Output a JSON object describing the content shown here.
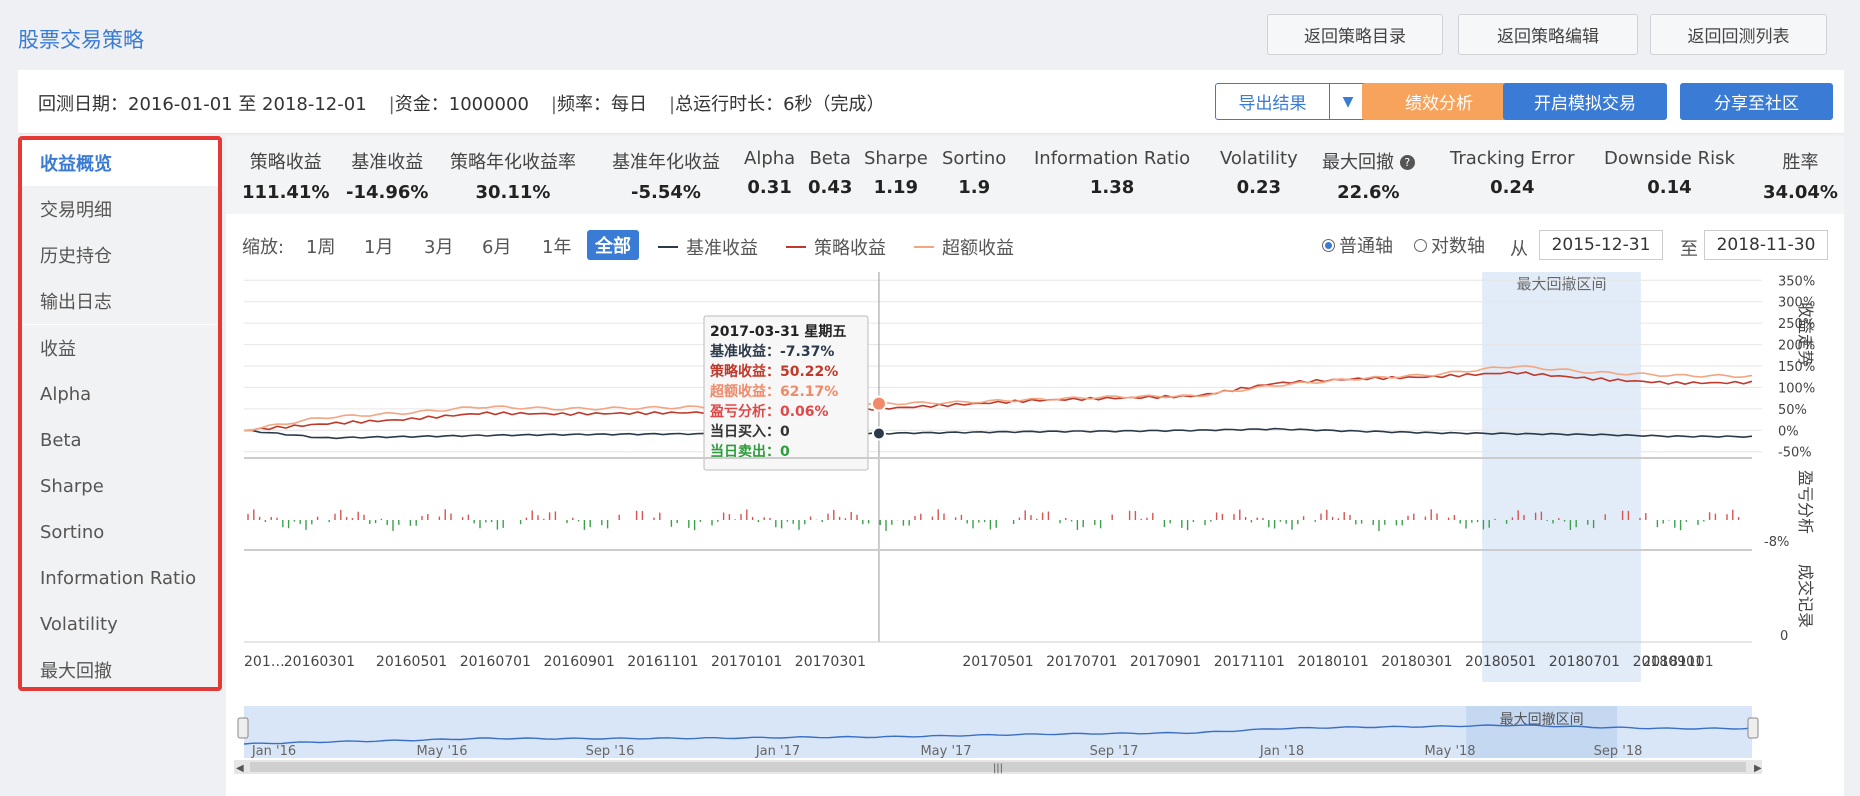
{
  "app_title": "股票交易策略",
  "top_buttons": [
    "返回策略目录",
    "返回策略编辑",
    "返回回测列表"
  ],
  "info": {
    "date_range": "回测日期：2016-01-01 至 2018-12-01",
    "capital": "资金：1000000",
    "frequency": "频率：每日",
    "runtime": "总运行时长：6秒（完成）",
    "separator": "|"
  },
  "actions": {
    "export": "导出结果",
    "performance": "绩效分析",
    "simulate": "开启模拟交易",
    "share": "分享至社区"
  },
  "colors": {
    "accent": "#3a7bd5",
    "orange": "#f7a35c",
    "benchmark": "#2b3a4a",
    "strategy": "#c0392b",
    "excess": "#f4a582",
    "highlight": "#e53935"
  },
  "sidebar": [
    {
      "label": "收益概览",
      "active": true
    },
    {
      "label": "交易明细"
    },
    {
      "label": "历史持仓"
    },
    {
      "label": "输出日志"
    },
    {
      "label": "收益"
    },
    {
      "label": "Alpha"
    },
    {
      "label": "Beta"
    },
    {
      "label": "Sharpe"
    },
    {
      "label": "Sortino"
    },
    {
      "label": "Information Ratio"
    },
    {
      "label": "Volatility"
    },
    {
      "label": "最大回撤"
    }
  ],
  "metrics": [
    {
      "name": "策略收益",
      "value": "111.41%"
    },
    {
      "name": "基准收益",
      "value": "-14.96%"
    },
    {
      "name": "策略年化收益率",
      "value": "30.11%"
    },
    {
      "name": "基准年化收益",
      "value": "-5.54%"
    },
    {
      "name": "Alpha",
      "value": "0.31"
    },
    {
      "name": "Beta",
      "value": "0.43"
    },
    {
      "name": "Sharpe",
      "value": "1.19"
    },
    {
      "name": "Sortino",
      "value": "1.9"
    },
    {
      "name": "Information Ratio",
      "value": "1.38"
    },
    {
      "name": "Volatility",
      "value": "0.23"
    },
    {
      "name": "最大回撤",
      "value": "22.6%"
    },
    {
      "name": "Tracking Error",
      "value": "0.24"
    },
    {
      "name": "Downside Risk",
      "value": "0.14"
    },
    {
      "name": "胜率",
      "value": "34.04%"
    }
  ],
  "zoom": {
    "label": "缩放:",
    "options": [
      "1周",
      "1月",
      "3月",
      "6月",
      "1年",
      "全部"
    ],
    "active": "全部"
  },
  "legend": [
    "基准收益",
    "策略收益",
    "超额收益"
  ],
  "axis_mode": {
    "normal": "普通轴",
    "log": "对数轴",
    "selected": "普通轴"
  },
  "range": {
    "from_label": "从",
    "from": "2015-12-31",
    "to_label": "至",
    "to": "2018-11-30"
  },
  "chart_data": {
    "type": "line",
    "title": "",
    "x": [
      "20160101",
      "20160301",
      "20160501",
      "20160701",
      "20160901",
      "20161101",
      "20170101",
      "20170301",
      "20170331",
      "20170501",
      "20170701",
      "20170901",
      "20171101",
      "20180101",
      "20180301",
      "20180501",
      "20180701",
      "20180901",
      "20181101",
      "20181130"
    ],
    "x_tick_labels": [
      "201…",
      "20160301",
      "20160501",
      "20160701",
      "20160901",
      "20161101",
      "20170101",
      "20170301",
      "20170501",
      "20170701",
      "20170901",
      "20171101",
      "20180101",
      "20180301",
      "20180501",
      "20180701",
      "20180901",
      "20181101"
    ],
    "y_tick_labels": [
      "350%",
      "300%",
      "250%",
      "200%",
      "150%",
      "100%",
      "50%",
      "0%",
      "-50%"
    ],
    "ylim": [
      -60,
      360
    ],
    "series": [
      {
        "name": "基准收益",
        "values": [
          0,
          -18,
          -15,
          -12,
          -10,
          -9,
          -8,
          -7.37,
          -7.4,
          -5,
          -3,
          -2,
          0,
          3,
          -2,
          -6,
          -8,
          -10,
          -14,
          -14.96
        ]
      },
      {
        "name": "策略收益",
        "values": [
          0,
          15,
          25,
          40,
          38,
          40,
          42,
          48,
          50.22,
          60,
          70,
          75,
          80,
          110,
          120,
          125,
          135,
          120,
          110,
          111.41
        ]
      },
      {
        "name": "超额收益",
        "values": [
          0,
          30,
          40,
          55,
          50,
          52,
          55,
          60,
          62.17,
          65,
          72,
          78,
          80,
          105,
          120,
          130,
          150,
          135,
          128,
          126
        ]
      }
    ],
    "panel_labels": [
      "收益走势",
      "盈亏分析",
      "成交记录"
    ],
    "pnl_axis_label": "-8%",
    "trade_axis_label": "0",
    "drawdown_label": "最大回撤区间",
    "navigator_labels": [
      "Jan '16",
      "May '16",
      "Sep '16",
      "Jan '17",
      "May '17",
      "Sep '17",
      "Jan '18",
      "May '18",
      "Sep '18"
    ],
    "navigator_drawdown_label": "最大回撤区间",
    "tooltip": {
      "date": "2017-03-31 星期五",
      "benchmark": "基准收益：-7.37%",
      "strategy": "策略收益：50.22%",
      "excess": "超额收益：62.17%",
      "pnl": "盈亏分析：0.06%",
      "buy": "当日买入：0",
      "sell": "当日卖出：0"
    }
  }
}
